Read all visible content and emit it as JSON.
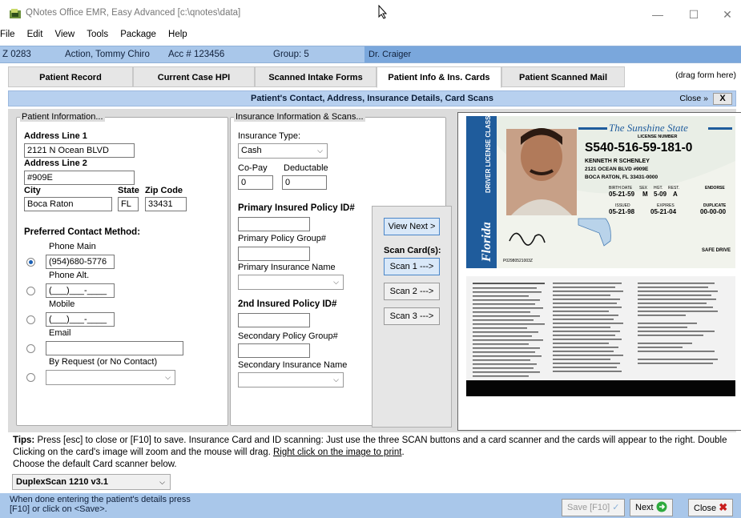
{
  "window": {
    "title": "QNotes Office EMR, Easy Advanced [c:\\qnotes\\data]",
    "minimize": "—",
    "maximize": "☐",
    "close": "✕"
  },
  "menu": [
    "File",
    "Edit",
    "View",
    "Tools",
    "Package",
    "Help"
  ],
  "infobar": {
    "patient_id": "Z 0283",
    "patient_name": "Action, Tommy Chiro",
    "account": "Acc # 123456",
    "group": "Group: 5",
    "doctor": "Dr. Craiger"
  },
  "tabs": [
    {
      "label": "Patient Record"
    },
    {
      "label": "Current Case HPI"
    },
    {
      "label": "Scanned Intake Forms"
    },
    {
      "label": "Patient Info & Ins. Cards"
    },
    {
      "label": "Patient Scanned Mail"
    }
  ],
  "drag_label": "(drag form here)",
  "subheader": {
    "title": "Patient's Contact, Address, Insurance Details, Card Scans",
    "close_label": "Close »",
    "close_x": "X"
  },
  "patient_info": {
    "legend": "Patient Information...",
    "address1_label": "Address Line 1",
    "address1": "2121 N Ocean BLVD",
    "address2_label": "Address Line 2",
    "address2": "#909E",
    "city_label": "City",
    "city": "Boca Raton",
    "state_label": "State",
    "state": "FL",
    "zip_label": "Zip Code",
    "zip": "33431",
    "contact_label": "Preferred Contact Method:",
    "phone_main_label": "Phone Main",
    "phone_main": "(954)680-5776",
    "phone_alt_label": "Phone Alt.",
    "phone_alt": "(___)___-____",
    "mobile_label": "Mobile",
    "mobile": "(___)___-____",
    "email_label": "Email",
    "email": "",
    "byrequest_label": "By Request (or No Contact)",
    "byrequest": ""
  },
  "insurance": {
    "legend": "Insurance Information & Scans...",
    "type_label": "Insurance Type:",
    "type": "Cash",
    "copay_label": "Co-Pay",
    "copay": "0",
    "deductable_label": "Deductable",
    "deductable": "0",
    "primary_id_label": "Primary Insured Policy ID#",
    "primary_id": "",
    "primary_group_label": "Primary Policy Group#",
    "primary_group": "",
    "primary_name_label": "Primary Insurance Name",
    "primary_name": "",
    "second_id_label": "2nd Insured Policy ID#",
    "second_id": "",
    "second_group_label": "Secondary Policy Group#",
    "second_group": "",
    "second_name_label": "Secondary Insurance Name",
    "second_name": ""
  },
  "scan_buttons": {
    "view_next": "View Next >",
    "scan_cards_label": "Scan Card(s):",
    "scan1": "Scan 1 --->",
    "scan2": "Scan 2 --->",
    "scan3": "Scan 3 --->"
  },
  "license": {
    "state_banner": "The Sunshine State",
    "license_number_label": "LICENSE NUMBER",
    "license_number": "S540-516-59-181-0",
    "name": "KENNETH R SCHENLEY",
    "street": "2121 OCEAN BLVD #909E",
    "citystate": "BOCA RATON, FL 33431-0000",
    "birth_label": "BIRTH DATE",
    "birth": "05-21-59",
    "sex_label": "SEX",
    "sex": "M",
    "hgt_label": "HGT.",
    "hgt": "5-09",
    "rest_label": "REST.",
    "rest": "A",
    "endorse_label": "ENDORSE",
    "issued_label": "ISSUED",
    "issued": "05-21-98",
    "expires_label": "EXPIRES",
    "expires": "05-21-04",
    "duplicate_label": "DUPLICATE",
    "duplicate": "00-00-00",
    "side_text": "DRIVER LICENSE CLASS E",
    "florida": "Florida",
    "safe_drive": "SAFE DRIVE",
    "control_no": "P02980521003Z"
  },
  "tips": {
    "prefix": "Tips:",
    "line1": " Press [esc] to close or [F10] to save.  Insurance Card and ID scanning:  Just use the three SCAN buttons and a card scanner and the cards will appear to the right.  Double Clicking on the card's image will zoom and the mouse will drag. ",
    "link": "Right click on the image to print",
    "line1_end": ".",
    "line2": "Choose the default Card scanner below."
  },
  "scanner": "DuplexScan 1210 v3.1",
  "status": {
    "line1": "When done entering the patient's details press",
    "line2": "[F10] or click on <Save>.",
    "save": "Save [F10]",
    "next": "Next",
    "close": "Close"
  }
}
